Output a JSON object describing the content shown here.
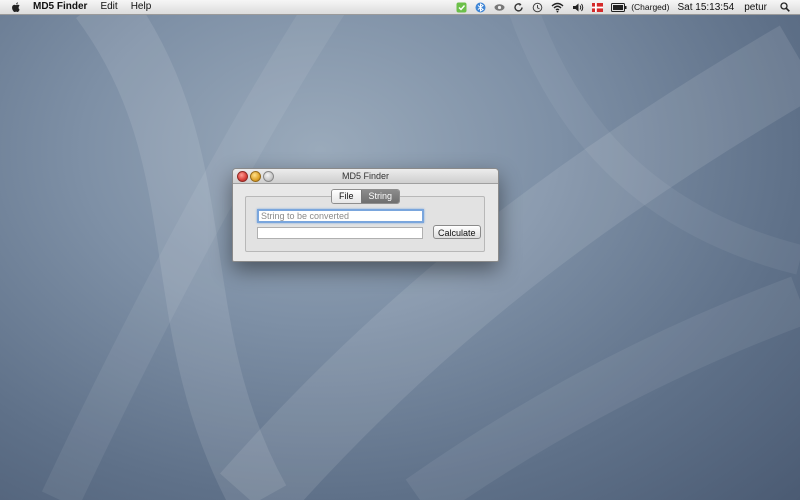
{
  "menubar": {
    "app_name": "MD5 Finder",
    "items": [
      "Edit",
      "Help"
    ],
    "status": {
      "battery_text": "(Charged)",
      "clock": "Sat 15:13:54",
      "user": "petur"
    },
    "icons": [
      "apple-icon",
      "green-sync-icon",
      "bluetooth-sync-icon",
      "eye-icon",
      "refresh-icon",
      "time-machine-icon",
      "wifi-icon",
      "volume-icon",
      "flag-icon",
      "battery-icon",
      "spotlight-icon"
    ]
  },
  "window": {
    "title": "MD5 Finder",
    "tabs": [
      {
        "label": "File",
        "selected": false
      },
      {
        "label": "String",
        "selected": true
      }
    ],
    "input": {
      "placeholder": "String to be converted",
      "value": ""
    },
    "output": {
      "value": ""
    },
    "calculate_label": "Calculate"
  },
  "colors": {
    "desktop": "#5f7189",
    "focus_ring": "#7aa6dd",
    "selected_segment": "#7a7a7a"
  }
}
